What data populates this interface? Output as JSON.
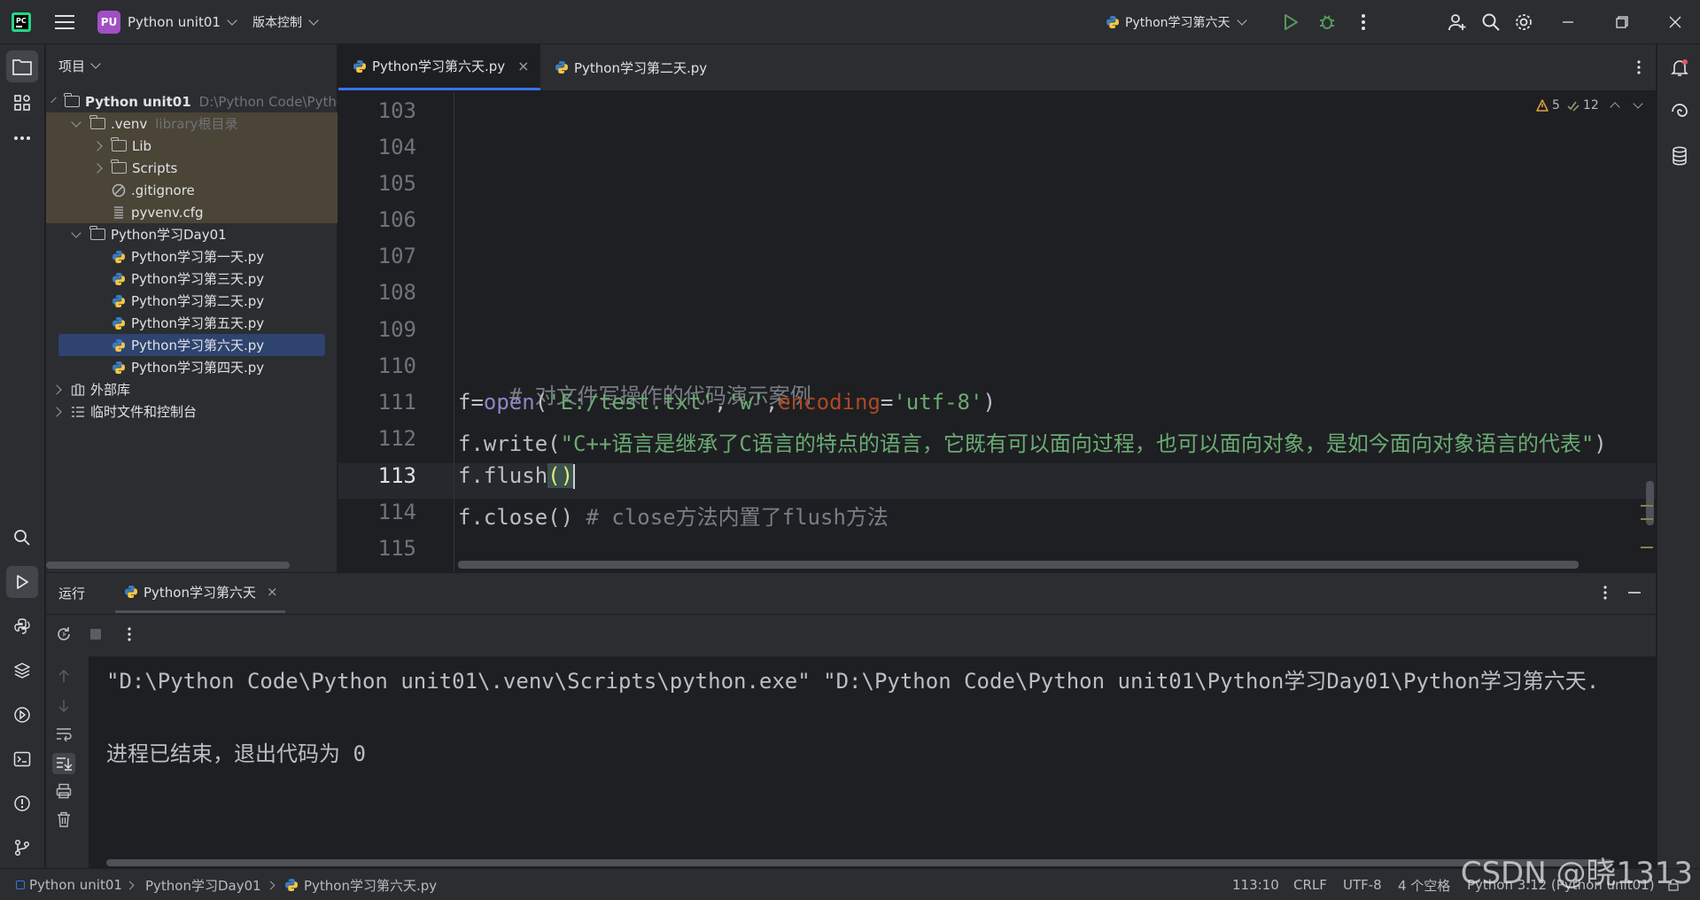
{
  "titlebar": {
    "project_badge": "PU",
    "project_name": "Python unit01",
    "vcs_label": "版本控制",
    "run_config": "Python学习第六天"
  },
  "project_panel": {
    "title": "项目",
    "items": [
      {
        "label": "Python unit01",
        "hint": "D:\\Python Code\\Python unit01"
      },
      {
        "label": ".venv",
        "hint": "library根目录"
      },
      {
        "label": "Lib"
      },
      {
        "label": "Scripts"
      },
      {
        "label": ".gitignore"
      },
      {
        "label": "pyvenv.cfg"
      },
      {
        "label": "Python学习Day01"
      },
      {
        "label": "Python学习第一天.py"
      },
      {
        "label": "Python学习第三天.py"
      },
      {
        "label": "Python学习第二天.py"
      },
      {
        "label": "Python学习第五天.py"
      },
      {
        "label": "Python学习第六天.py"
      },
      {
        "label": "Python学习第四天.py"
      },
      {
        "label": "外部库"
      },
      {
        "label": "临时文件和控制台"
      }
    ]
  },
  "editor": {
    "tabs": [
      {
        "label": "Python学习第六天.py"
      },
      {
        "label": "Python学习第二天.py"
      }
    ],
    "inspections": {
      "warnings": "5",
      "weak_warnings": "12"
    },
    "line_numbers": [
      "103",
      "104",
      "105",
      "106",
      "107",
      "108",
      "109",
      "110",
      "111",
      "112",
      "113",
      "114",
      "115"
    ],
    "code": {
      "l110": "# 对文件写操作的代码演示案例",
      "l111_a": "f=",
      "l111_b": "open",
      "l111_c": "(",
      "l111_d": "'E:/test.txt'",
      "l111_e": ",",
      "l111_f": "'w'",
      "l111_g": ",",
      "l111_h": "encoding",
      "l111_i": "=",
      "l111_j": "'utf-8'",
      "l111_k": ")",
      "l112_a": "f.write(",
      "l112_b": "\"C++语言是继承了C语言的特点的语言，它既有可以面向过程，也可以面向对象，是如今面向对象语言的代表\"",
      "l112_c": ")",
      "l113_a": "f.flush",
      "l113_b": "()",
      "l114_a": "f.close() ",
      "l114_b": "# close方法内置了flush方法"
    }
  },
  "run_panel": {
    "title": "运行",
    "tab": "Python学习第六天",
    "output": [
      "\"D:\\Python Code\\Python unit01\\.venv\\Scripts\\python.exe\" \"D:\\Python Code\\Python unit01\\Python学习Day01\\Python学习第六天.",
      "",
      "进程已结束，退出代码为 0"
    ]
  },
  "statusbar": {
    "breadcrumbs": [
      "Python unit01",
      "Python学习Day01",
      "Python学习第六天.py"
    ],
    "position": "113:10",
    "line_ending": "CRLF",
    "encoding": "UTF-8",
    "indent": "4 个空格",
    "interpreter": "Python 3.12 (Python unit01)"
  },
  "watermark": "CSDN @晓1313"
}
